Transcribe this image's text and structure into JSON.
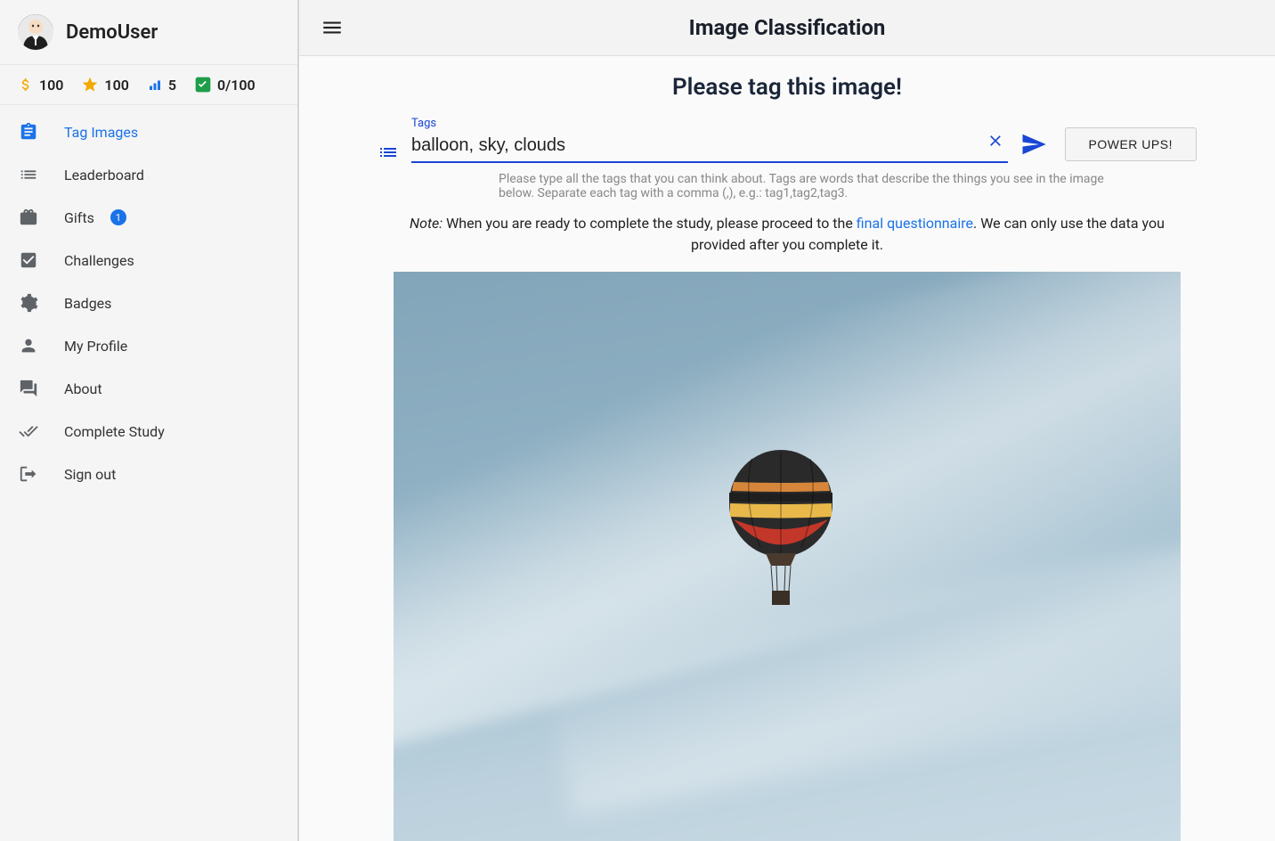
{
  "user": {
    "name": "DemoUser"
  },
  "stats": {
    "coins": "100",
    "stars": "100",
    "level": "5",
    "progress": "0/100"
  },
  "sidebar": {
    "items": [
      {
        "label": "Tag Images",
        "badge": null
      },
      {
        "label": "Leaderboard",
        "badge": null
      },
      {
        "label": "Gifts",
        "badge": "1"
      },
      {
        "label": "Challenges",
        "badge": null
      },
      {
        "label": "Badges",
        "badge": null
      },
      {
        "label": "My Profile",
        "badge": null
      },
      {
        "label": "About",
        "badge": null
      },
      {
        "label": "Complete Study",
        "badge": null
      },
      {
        "label": "Sign out",
        "badge": null
      }
    ]
  },
  "header": {
    "title": "Image Classification"
  },
  "content": {
    "title": "Please tag this image!",
    "tags_label": "Tags",
    "tags_value": "balloon, sky, clouds",
    "helper": "Please type all the tags that you can think about. Tags are words that describe the things you see in the image below. Separate each tag with a comma (,), e.g.: tag1,tag2,tag3.",
    "note_prefix": "Note:",
    "note_mid1": " When you are ready to complete the study, please proceed to the ",
    "note_link": "final questionnaire",
    "note_mid2": ". We can only use the data you provided after you complete it.",
    "powerups": "POWER UPS!"
  }
}
